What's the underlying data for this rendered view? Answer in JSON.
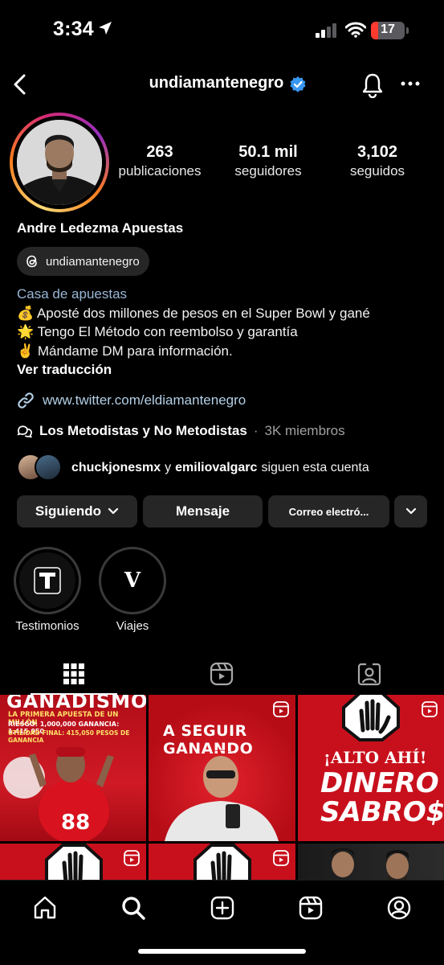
{
  "status_bar": {
    "time": "3:34",
    "battery": "17"
  },
  "header": {
    "username": "undiamantenegro"
  },
  "stats": [
    {
      "value": "263",
      "label": "publicaciones"
    },
    {
      "value": "50.1 mil",
      "label": "seguidores"
    },
    {
      "value": "3,102",
      "label": "seguidos"
    }
  ],
  "profile": {
    "full_name": "Andre Ledezma Apuestas",
    "threads_handle": "undiamantenegro",
    "category": "Casa de apuestas",
    "bio_lines": [
      "💰 Aposté dos millones de pesos en el Super Bowl y gané",
      "🌟 Tengo El Método con reembolso y garantía",
      "✌️ Mándame DM para información."
    ],
    "translate": "Ver traducción",
    "link": "www.twitter.com/eldiamantenegro",
    "community_name": "Los Metodistas y No Metodistas",
    "community_sep": "·",
    "community_members": "3K miembros",
    "followed_by_1": "chuckjonesmx",
    "followed_by_and": "y",
    "followed_by_2": "emiliovalgarc",
    "followed_by_suffix": "siguen esta cuenta"
  },
  "actions": {
    "following": "Siguiendo",
    "message": "Mensaje",
    "email": "Correo electró..."
  },
  "highlights": [
    {
      "label": "Testimonios",
      "letter": "T"
    },
    {
      "label": "Viajes",
      "letter": "V"
    }
  ],
  "posts": {
    "p1_title": "GANADISMO",
    "p1_line1": "LA PRIMERA APUESTA DE UN MILLÓN",
    "p1_line2": "RIESGO: 1,000,000   GANANCIA: 1,415,050",
    "p1_line3": "UTILIDAD FINAL: 415,050 PESOS DE GANANCIA",
    "p2_title": "A SEGUIR GANANDO",
    "p3_line1": "¡ALTO AHÍ!",
    "p3_line2": "DINERO",
    "p3_line3": "SABRO$O"
  },
  "icons": {
    "tab_grid": "grid-icon",
    "tab_reels": "reels-icon",
    "tab_tagged": "tagged-icon",
    "nav": [
      "home-icon",
      "search-icon",
      "create-icon",
      "reels-icon",
      "profile-icon"
    ]
  },
  "colors": {
    "accent_red": "#c8101c",
    "link_blue": "#b3cfe6",
    "verified": "#3897f0",
    "button_bg": "#262626"
  }
}
